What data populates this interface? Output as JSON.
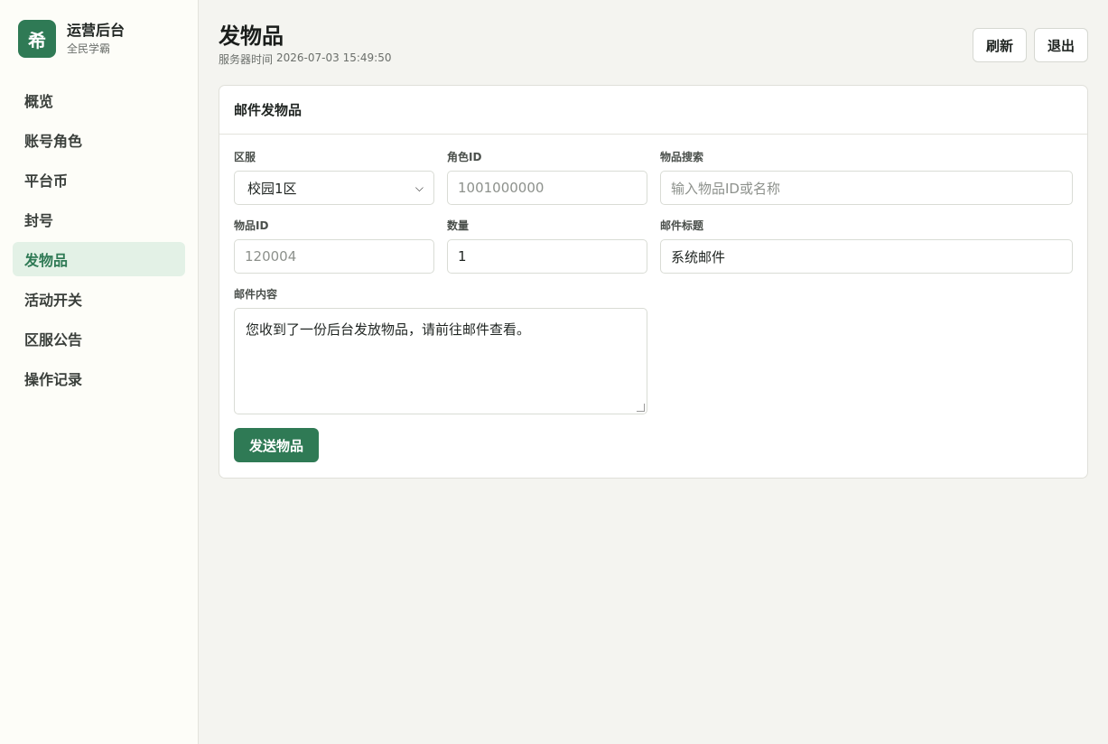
{
  "brand": {
    "logo_char": "希",
    "title": "运营后台",
    "subtitle": "全民学霸"
  },
  "sidebar": {
    "items": [
      {
        "label": "概览",
        "active": false
      },
      {
        "label": "账号角色",
        "active": false
      },
      {
        "label": "平台币",
        "active": false
      },
      {
        "label": "封号",
        "active": false
      },
      {
        "label": "发物品",
        "active": true
      },
      {
        "label": "活动开关",
        "active": false
      },
      {
        "label": "区服公告",
        "active": false
      },
      {
        "label": "操作记录",
        "active": false
      }
    ]
  },
  "header": {
    "title": "发物品",
    "server_time_label": "服务器时间",
    "server_time_value": "2026-07-03 15:49:50",
    "refresh_label": "刷新",
    "logout_label": "退出"
  },
  "card": {
    "title": "邮件发物品",
    "fields": {
      "server": {
        "label": "区服",
        "value": "校园1区"
      },
      "role_id": {
        "label": "角色ID",
        "placeholder": "1001000000"
      },
      "item_search": {
        "label": "物品搜索",
        "placeholder": "输入物品ID或名称"
      },
      "item_id": {
        "label": "物品ID",
        "placeholder": "120004"
      },
      "quantity": {
        "label": "数量",
        "value": "1"
      },
      "mail_title": {
        "label": "邮件标题",
        "value": "系统邮件"
      },
      "mail_content": {
        "label": "邮件内容",
        "value": "您收到了一份后台发放物品，请前往邮件查看。"
      }
    },
    "submit_label": "发送物品"
  },
  "colors": {
    "accent": "#2f7a55",
    "active_nav_bg": "#e3f1e6"
  }
}
